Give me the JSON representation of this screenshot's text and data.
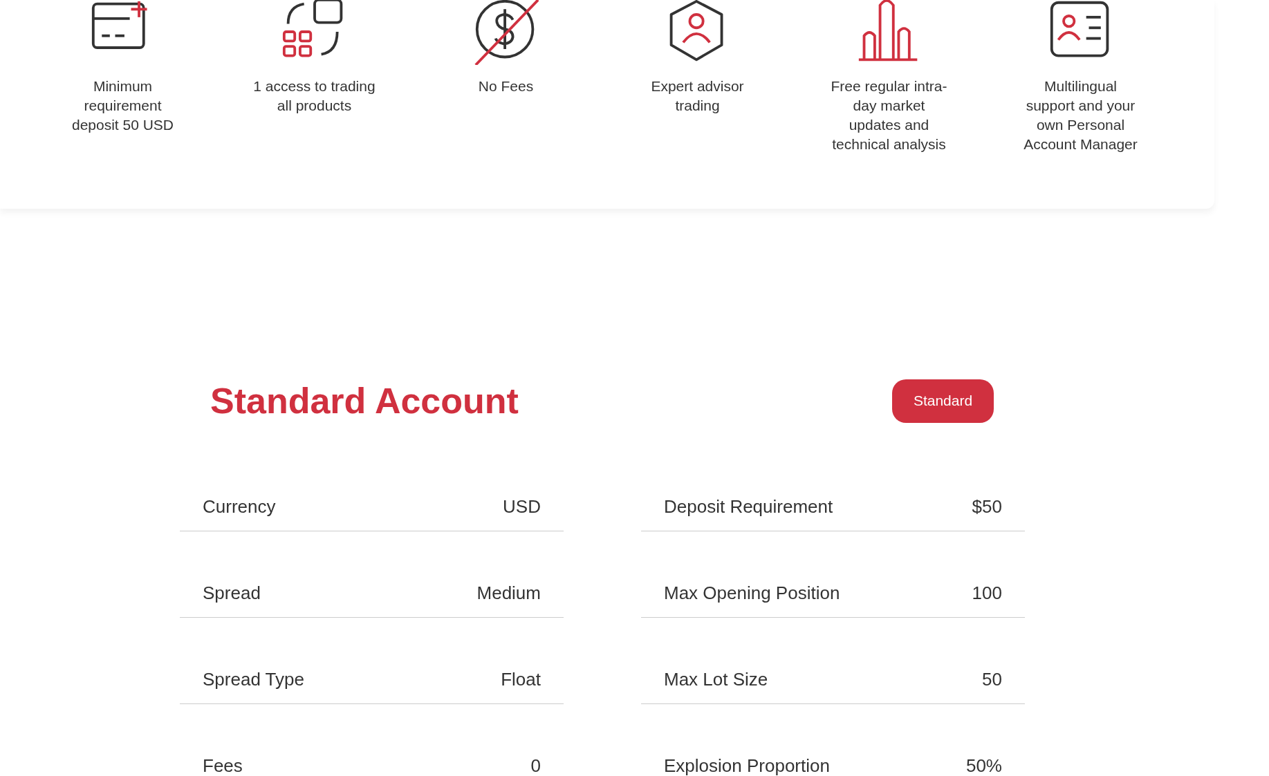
{
  "features": [
    {
      "kind": "card-plus",
      "text": "Minimum requirement deposit 50 USD"
    },
    {
      "kind": "grid-arrows",
      "text": "1 access to trading all products"
    },
    {
      "kind": "no-fee",
      "text": "No Fees"
    },
    {
      "kind": "user-hexagon",
      "text": "Expert advisor trading"
    },
    {
      "kind": "bar-chart",
      "text": "Free regular intra-day market updates and technical analysis"
    },
    {
      "kind": "id-card",
      "text": "Multilingual support and your own Personal Account Manager"
    }
  ],
  "account": {
    "title": "Standard Account",
    "button": "Standard"
  },
  "rows": [
    [
      {
        "label": "Currency",
        "value": "USD"
      },
      {
        "label": "Deposit Requirement",
        "value": "$50"
      }
    ],
    [
      {
        "label": "Spread",
        "value": "Medium"
      },
      {
        "label": "Max Opening Position",
        "value": "100"
      }
    ],
    [
      {
        "label": "Spread Type",
        "value": "Float"
      },
      {
        "label": "Max Lot Size",
        "value": "50"
      }
    ],
    [
      {
        "label": "Fees",
        "value": "0"
      },
      {
        "label": "Explosion Proportion",
        "value": "50%"
      }
    ]
  ]
}
